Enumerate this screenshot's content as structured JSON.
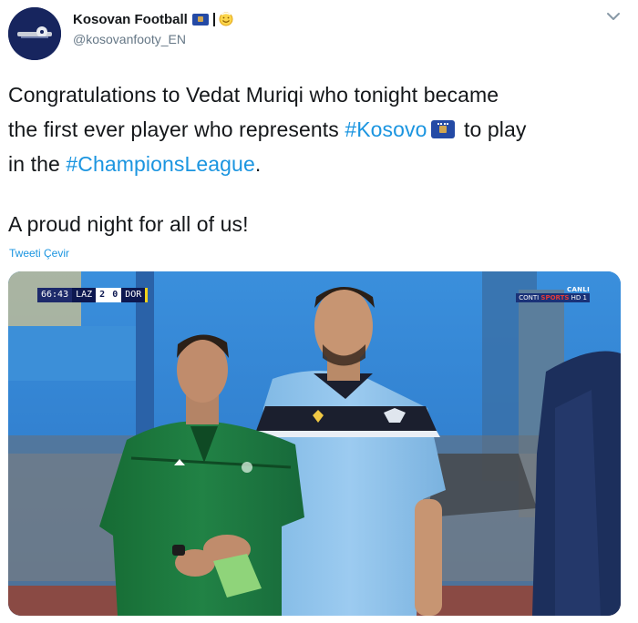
{
  "account": {
    "display_name": "Kosovan Football",
    "handle": "@kosovanfooty_EN",
    "avatar_icon": "ball-on-grass-avatar",
    "badges": [
      "kosovo-flag-icon",
      "separator-bar",
      "smiling-emoji-icon"
    ]
  },
  "tweet": {
    "line1": "Congratulations to Vedat Muriqi who tonight became",
    "line2_before": "the first ever player who represents ",
    "hashtag_kosovo": "#Kosovo",
    "line2_after": " to play",
    "line3_before": "in the ",
    "hashtag_cl": "#ChampionsLeague",
    "line3_after": ".",
    "line4": "A proud night for all of us!"
  },
  "translate_label": "Tweeti Çevir",
  "media": {
    "scoreboard": {
      "clock": "66:43",
      "team_home": "LAZ",
      "score_home": "2",
      "score_away": "0",
      "team_away": "DOR"
    },
    "channel": {
      "live_label": "CANLI",
      "name_a": "CONTI",
      "name_b": "SPORTS",
      "name_c": "HD 1"
    }
  },
  "colors": {
    "text": "#14171a",
    "secondary": "#657786",
    "link": "#1b95e0",
    "avatar_bg": "#17255e",
    "lazio_blue": "#8cc3ea",
    "referee_green": "#1f7a3e"
  }
}
